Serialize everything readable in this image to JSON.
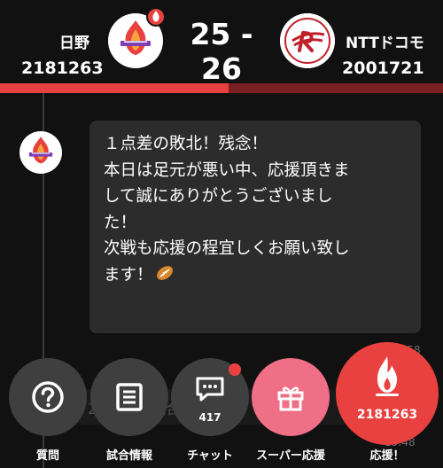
{
  "match": {
    "home": {
      "name": "日野",
      "points": "2181263"
    },
    "away": {
      "name": "NTTドコモ",
      "points": "2001721"
    },
    "score": "25 - 26"
  },
  "timeline": {
    "message_lines": [
      "１点差の敗北！残念！",
      "本日は足元が悪い中、応援頂きま",
      "して誠にありがとうございまし",
      "た！",
      "次戦も応援の程宜しくお願い致し",
      "ます！"
    ],
    "timestamp_partial": "15:58",
    "faded_message": "25 26 で試合終了",
    "timestamp_bottom": "15:48"
  },
  "actions": {
    "question_label": "質問",
    "info_label": "試合情報",
    "chat_label": "チャット",
    "chat_count": "417",
    "super_label": "スーパー応援",
    "cheer_label": "応援！",
    "cheer_count": "2181263"
  },
  "icons": {
    "question": "question-circle-icon",
    "info": "document-lines-icon",
    "chat": "speech-bubble-icon",
    "super": "gift-box-icon",
    "cheer": "flame-icon",
    "ball": "rugby-ball-icon"
  },
  "colors": {
    "accent": "#e8413f",
    "accent_dark": "#7a1f22",
    "super": "#ee6f86",
    "background": "#111111",
    "bubble": "#2c2c2c",
    "button": "#3f3f3f"
  }
}
